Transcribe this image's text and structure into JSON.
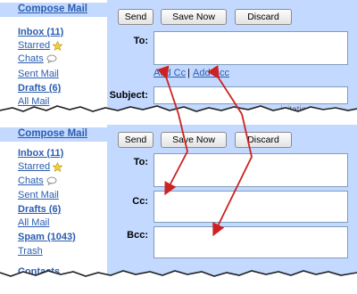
{
  "sidebar": {
    "compose_label": "Compose Mail",
    "items": [
      {
        "label": "Inbox (11)"
      },
      {
        "label": "Starred"
      },
      {
        "label": "Chats"
      },
      {
        "label": "Sent Mail"
      },
      {
        "label": "Drafts (6)"
      },
      {
        "label": "All Mail"
      },
      {
        "label": "Spam (1043)"
      },
      {
        "label": "Trash"
      },
      {
        "label": "Contacts"
      }
    ]
  },
  "toolbar": {
    "send_label": "Send",
    "save_label": "Save Now",
    "discard_label": "Discard"
  },
  "compose": {
    "to_label": "To:",
    "cc_label": "Cc:",
    "bcc_label": "Bcc:",
    "subject_label": "Subject:",
    "add_cc_label": "Add Cc",
    "separator": "|",
    "add_bcc_label": "Add Bcc",
    "partial_text": "...initatio"
  },
  "colors": {
    "accent": "#c3d9ff",
    "link": "#2a5db0",
    "arrow": "#cc2222"
  },
  "icons": {
    "starred": "star-icon",
    "chats": "chat-bubble-icon"
  }
}
